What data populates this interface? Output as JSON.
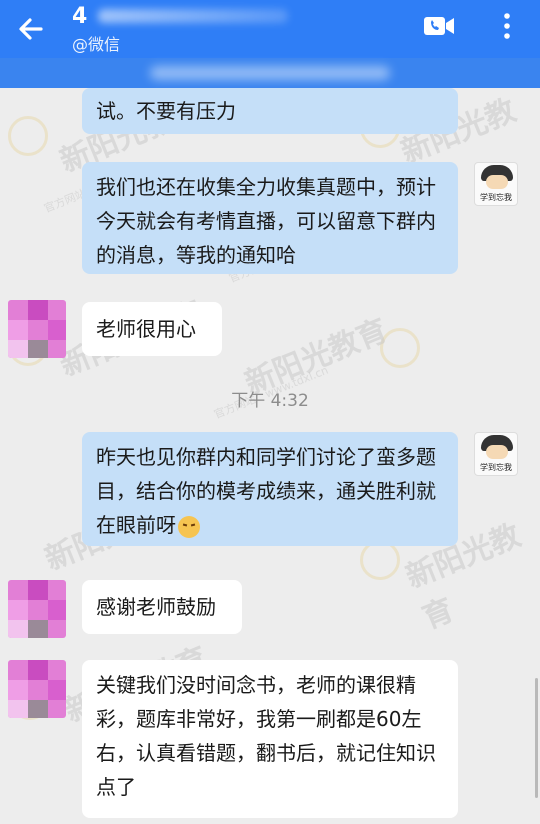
{
  "header": {
    "title": "4",
    "subtitle": "@微信",
    "colors": {
      "bar": "#2f7ef6",
      "banner": "#3a84ef"
    },
    "icons": {
      "back": "arrow-left-icon",
      "call": "video-call-icon",
      "more": "more-vertical-icon"
    }
  },
  "watermark": {
    "text": "新阳光教育",
    "site": "官方网站：www.tdxl.cn"
  },
  "messages": [
    {
      "side": "out",
      "text": "试。不要有压力"
    },
    {
      "side": "out",
      "text": "我们也还在收集全力收集真题中，预计今天就会有考情直播，可以留意下群内的消息，等我的通知哈",
      "avatar_caption": "学到忘我"
    },
    {
      "side": "in",
      "text": "老师很用心"
    },
    {
      "side": "time",
      "text": "下午 4:32"
    },
    {
      "side": "out",
      "text": "昨天也见你群内和同学们讨论了蛮多题目，结合你的模考成绩来，通关胜利就在眼前呀",
      "avatar_caption": "学到忘我",
      "emoji": "smile-emoji"
    },
    {
      "side": "in",
      "text": "感谢老师鼓励"
    },
    {
      "side": "in",
      "text": "关键我们没时间念书，老师的课很精彩，题库非常好，我第一刷都是60左右，认真看错题，翻书后，就记住知识点了"
    }
  ],
  "colors": {
    "bubble_out": "#c5dff8",
    "bubble_in": "#ffffff",
    "chat_bg": "#ededed"
  }
}
